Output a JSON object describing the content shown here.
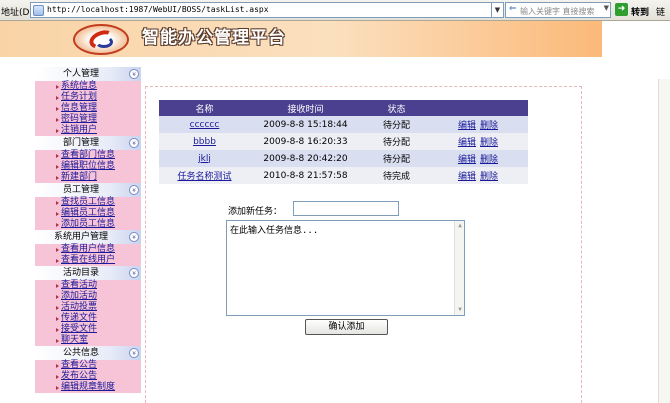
{
  "address_bar": {
    "label": "地址(D)",
    "url": "http://localhost:1987/WebUI/BOSS/taskList.aspx",
    "search_placeholder": "输入关键字 直接搜索",
    "go_label": "转到",
    "links_label": "链"
  },
  "header": {
    "title": "智能办公管理平台"
  },
  "sidebar": {
    "groups": [
      {
        "title": "个人管理",
        "items": [
          "系统信息",
          "任务计划",
          "信息管理",
          "密码管理",
          "注销用户"
        ]
      },
      {
        "title": "部门管理",
        "items": [
          "查看部门信息",
          "编辑职位信息",
          "新建部门"
        ]
      },
      {
        "title": "员工管理",
        "items": [
          "查找员工信息",
          "编辑员工信息",
          "添加员工信息"
        ]
      },
      {
        "title": "系统用户管理",
        "items": [
          "查看用户信息",
          "查看在线用户"
        ]
      },
      {
        "title": "活动目录",
        "items": [
          "查看活动",
          "添加活动",
          "活动投票",
          "传递文件",
          "接受文件",
          "聊天室"
        ]
      },
      {
        "title": "公共信息",
        "items": [
          "查看公告",
          "发布公告",
          "编辑规章制度"
        ]
      }
    ]
  },
  "task_table": {
    "headers": [
      "名称",
      "接收时间",
      "状态",
      ""
    ],
    "rows": [
      {
        "name": "cccccc",
        "time": "2009-8-8 15:18:44",
        "status": "待分配",
        "edit": "编辑",
        "delete": "删除"
      },
      {
        "name": "bbbb",
        "time": "2009-8-8 16:20:33",
        "status": "待分配",
        "edit": "编辑",
        "delete": "删除"
      },
      {
        "name": "jklj",
        "time": "2009-8-8 20:42:20",
        "status": "待分配",
        "edit": "编辑",
        "delete": "删除"
      },
      {
        "name": "任务名称测试",
        "time": "2010-8-8 21:57:58",
        "status": "待完成",
        "edit": "编辑",
        "delete": "删除"
      }
    ]
  },
  "add_form": {
    "label": "添加新任务：",
    "input_value": "",
    "textarea_value": "在此输入任务信息...",
    "submit_label": "确认添加"
  }
}
